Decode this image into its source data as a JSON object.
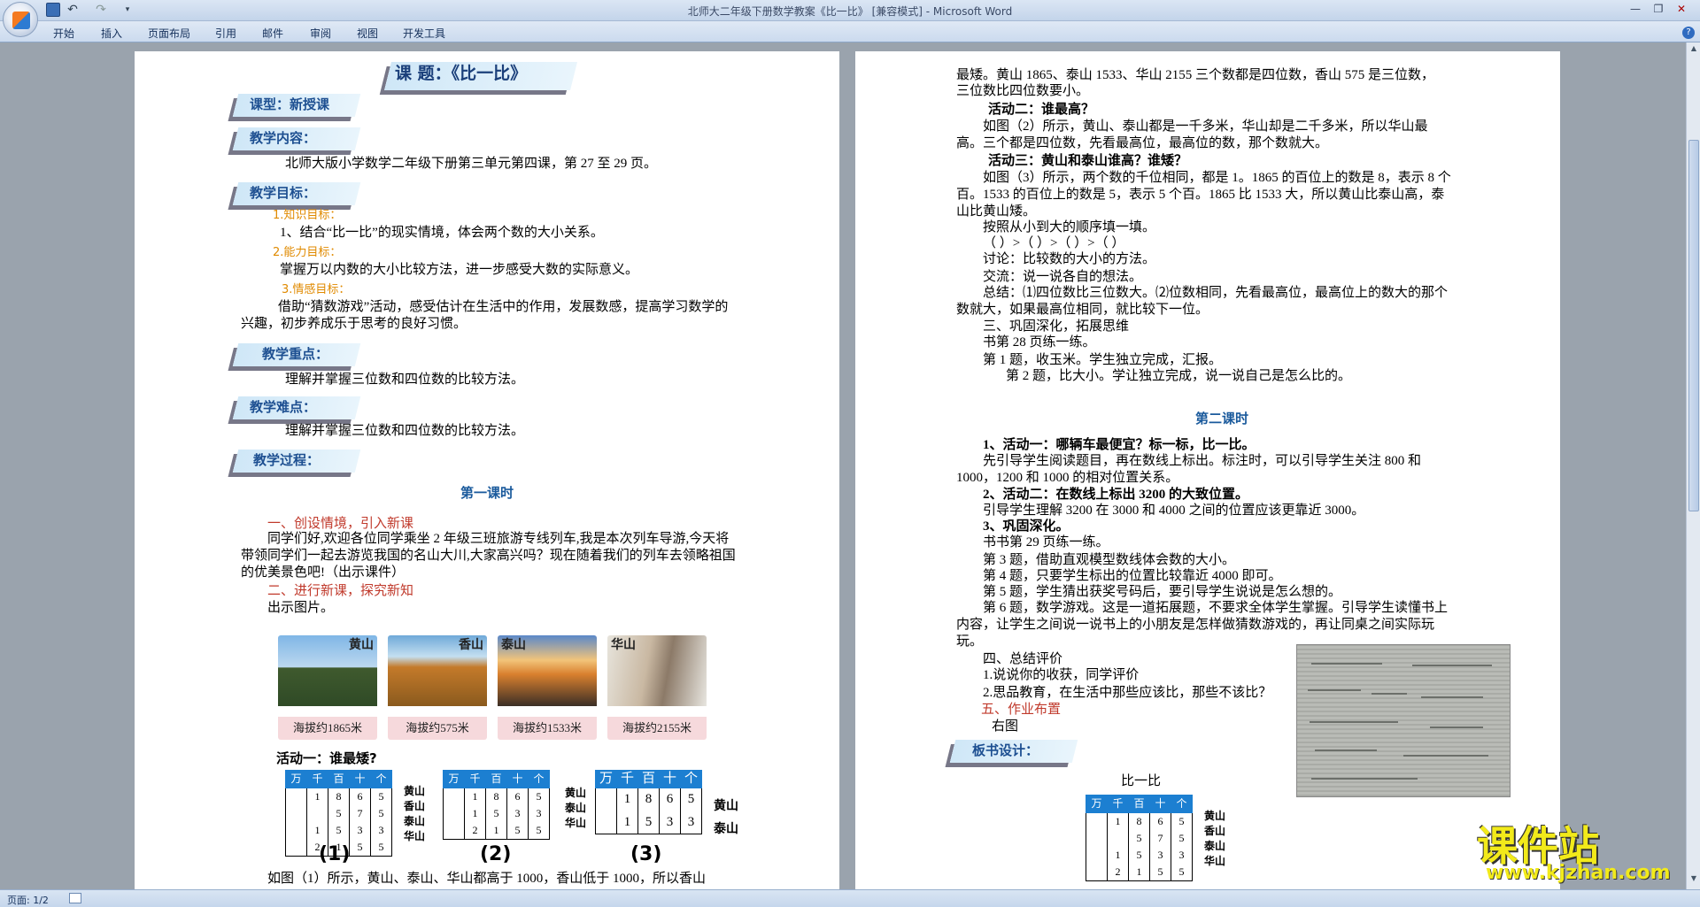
{
  "window": {
    "title": "北师大二年级下册数学教案《比一比》 [兼容模式] - Microsoft Word"
  },
  "qat": {
    "undo": "↶",
    "redo": "↷",
    "more": "▾"
  },
  "winbtns": {
    "min": "—",
    "max": "❐",
    "close": "✕"
  },
  "ribbon": {
    "tabs": [
      "开始",
      "插入",
      "页面布局",
      "引用",
      "邮件",
      "审阅",
      "视图",
      "开发工具"
    ],
    "help": "?"
  },
  "status": {
    "page": "页面: 1/2"
  },
  "page1": {
    "title": "课  题：《比一比》",
    "type": "课型：新授课",
    "content_h": "教学内容：",
    "content": "北师大版小学数学二年级下册第三单元第四课，第 27 至 29 页。",
    "goal_h": "教学目标：",
    "g1": "1.知识目标：",
    "g1t": "1、结合“比一比”的现实情境，体会两个数的大小关系。",
    "g2": "2.能力目标：",
    "g2t": "掌握万以内数的大小比较方法，进一步感受大数的实际意义。",
    "g3": "3.情感目标：",
    "g3t": "借助“猜数游戏”活动，感受估计在生活中的作用，发展数感，提高学习数学的兴趣，初步养成乐于思考的良好习惯。",
    "key_h": "教学重点：",
    "key": "理解并掌握三位数和四位数的比较方法。",
    "diff_h": "教学难点：",
    "diff": "理解并掌握三位数和四位数的比较方法。",
    "proc_h": "教学过程：",
    "lesson1": "第一课时",
    "s1": "一、创设情境，引入新课",
    "s1t": "同学们好,欢迎各位同学乘坐 2 年级三班旅游专线列车,我是本次列车导游,今天将带领同学们一起去游览我国的名山大川,大家高兴吗？现在随着我们的列车去领略祖国的优美景色吧!（出示课件）",
    "s2": "二、进行新课，探究新知",
    "show": "出示图片。",
    "photos": [
      {
        "name": "黄山",
        "cap": "海拔约1865米"
      },
      {
        "name": "香山",
        "cap": "海拔约575米"
      },
      {
        "name": "泰山",
        "cap": "海拔约1533米"
      },
      {
        "name": "华山",
        "cap": "海拔约2155米"
      }
    ],
    "act1": "活动一：谁最矮?",
    "head": [
      "万",
      "千",
      "百",
      "十",
      "个"
    ],
    "t1": [
      [
        "",
        "1",
        "8",
        "6",
        "5"
      ],
      [
        "",
        "",
        "5",
        "7",
        "5"
      ],
      [
        "",
        "1",
        "5",
        "3",
        "3"
      ],
      [
        "",
        "2",
        "1",
        "5",
        "5"
      ]
    ],
    "t1n": [
      "黄山",
      "香山",
      "泰山",
      "华山"
    ],
    "t2": [
      [
        "",
        "1",
        "8",
        "6",
        "5"
      ],
      [
        "",
        "1",
        "5",
        "3",
        "3"
      ],
      [
        "",
        "2",
        "1",
        "5",
        "5"
      ]
    ],
    "t2n": [
      "黄山",
      "泰山",
      "华山"
    ],
    "t3": [
      [
        "",
        "1",
        "8",
        "6",
        "5"
      ],
      [
        "",
        "1",
        "5",
        "3",
        "3"
      ]
    ],
    "t3n": [
      "黄山",
      "泰山"
    ],
    "caps": [
      "(1)",
      "(2)",
      "(3)"
    ],
    "bottom": "如图（1）所示，黄山、泰山、华山都高于 1000，香山低于 1000，所以香山"
  },
  "page2": {
    "l1": "最矮。黄山 1865、泰山 1533、华山 2155 三个数都是四位数，香山 575 是三位数，",
    "l2": "三位数比四位数要小。",
    "a2": "活动二：谁最高？",
    "a2t": "如图（2）所示，黄山、泰山都是一千多米，华山却是二千多米，所以华山最高。三个都是四位数，先看最高位，最高位的数，那个数就大。",
    "a3": "活动三：黄山和泰山谁高？谁矮？",
    "a3t": "如图（3）所示，两个数的千位相同，都是 1。1865 的百位上的数是 8，表示 8 个百。1533 的百位上的数是 5，表示 5 个百。1865 比 1533 大，所以黄山比泰山高，泰山比黄山矮。",
    "order": "按照从小到大的顺序填一填。",
    "blanks": "（        ）>（        ）>（        ）>（        ）",
    "disc": "讨论：比较数的大小的方法。",
    "comm": "交流：说一说各自的想法。",
    "sum": "总结：⑴四位数比三位数大。⑵位数相同，先看最高位，最高位上的数大的那个数就大，如果最高位相同，就比较下一位。",
    "s3": "三、巩固深化，拓展思维",
    "p28": "书第 28 页练一练。",
    "q1": "第 1 题，收玉米。学生独立完成，汇报。",
    "q2": "第 2 题，比大小。学让独立完成，说一说自己是怎么比的。",
    "lesson2": "第二课时",
    "b1": "1、活动一：哪辆车最便宜？标一标，比一比。",
    "b1t": "先引导学生阅读题目，再在数线上标出。标注时，可以引导学生关注 800 和 1000，1200 和 1000 的相对位置关系。",
    "b2": "2、活动二：在数线上标出 3200 的大致位置。",
    "b2t": "引导学生理解 3200 在 3000 和 4000 之间的位置应该更靠近 3000。",
    "b3": "3、巩固深化。",
    "p29": "书书第 29 页练一练。",
    "q3": "第 3 题，借助直观模型数线体会数的大小。",
    "q4": "第 4 题，只要学生标出的位置比较靠近 4000 即可。",
    "q5": "第 5 题，学生猜出获奖号码后，要引导学生说说是怎么想的。",
    "q6": "第 6 题，数学游戏。这是一道拓展题，不要求全体学生掌握。引导学生读懂书上内容，让学生之间说一说书上的小朋友是怎样做猜数游戏的，再让同桌之间实际玩玩。",
    "s4": "四、总结评价",
    "s4a": "1.说说你的收获，同学评价",
    "s4b": "2.思品教育，在生活中那些应该比，那些不该比？",
    "s5": "五、作业布置",
    "right": "右图",
    "board_h": "板书设计：",
    "board": "比一比",
    "bt": [
      [
        "",
        "1",
        "8",
        "6",
        "5"
      ],
      [
        "",
        "",
        "5",
        "7",
        "5"
      ],
      [
        "",
        "1",
        "5",
        "3",
        "3"
      ],
      [
        "",
        "2",
        "1",
        "5",
        "5"
      ]
    ],
    "btn": [
      "黄山",
      "香山",
      "泰山",
      "华山"
    ]
  },
  "watermark": {
    "main": "课件站",
    "url": "www.kjzhan.com"
  }
}
